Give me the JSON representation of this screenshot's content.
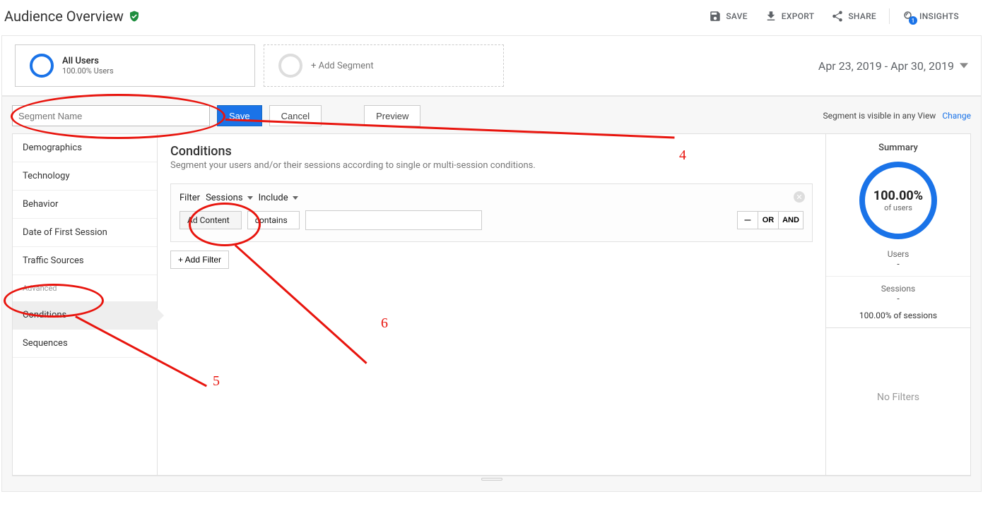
{
  "header": {
    "title": "Audience Overview",
    "actions": {
      "save": "SAVE",
      "export": "EXPORT",
      "share": "SHARE",
      "insights": "INSIGHTS",
      "insights_badge": "1"
    }
  },
  "segment_bar": {
    "all_users": {
      "title": "All Users",
      "sub": "100.00% Users"
    },
    "add_segment": "+ Add Segment",
    "date_range": "Apr 23, 2019 - Apr 30, 2019"
  },
  "builder": {
    "segment_name_placeholder": "Segment Name",
    "buttons": {
      "save": "Save",
      "cancel": "Cancel",
      "preview": "Preview"
    },
    "visibility": {
      "text": "Segment is visible in any View",
      "change": "Change"
    }
  },
  "sidenav": {
    "items": [
      "Demographics",
      "Technology",
      "Behavior",
      "Date of First Session",
      "Traffic Sources"
    ],
    "advanced_label": "Advanced",
    "advanced_items": [
      "Conditions",
      "Sequences"
    ],
    "active": "Conditions"
  },
  "conditions": {
    "title": "Conditions",
    "subtitle": "Segment your users and/or their sessions according to single or multi-session conditions.",
    "filter_label": "Filter",
    "sessions": "Sessions",
    "include": "Include",
    "dimension": "Ad Content",
    "operator": "contains",
    "row_ops": {
      "minus": "–",
      "or": "OR",
      "and": "AND"
    },
    "add_filter": "+ Add Filter"
  },
  "summary": {
    "title": "Summary",
    "donut_pct": "100.00%",
    "donut_sub": "of users",
    "users_label": "Users",
    "users_val": "-",
    "sessions_label": "Sessions",
    "sessions_val": "-",
    "sessions_pct": "100.00% of sessions",
    "no_filters": "No Filters"
  },
  "annotations": {
    "n4": "4",
    "n5": "5",
    "n6": "6"
  }
}
